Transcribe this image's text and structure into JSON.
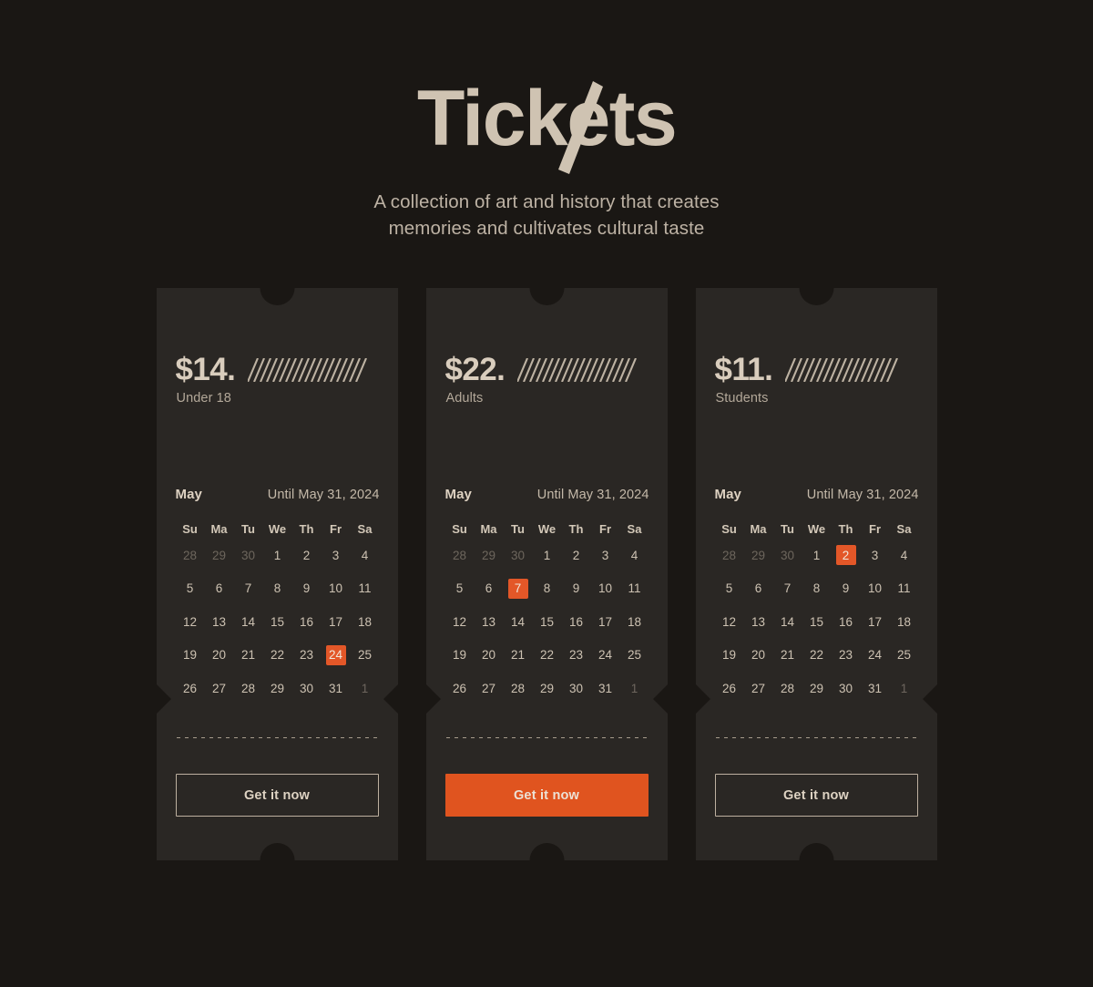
{
  "header": {
    "brand": "Tickets",
    "brand_mark_icon": "ticket-slash-mark",
    "tagline_line1": "A collection of art and history that creates",
    "tagline_line2": "memories and cultivates cultural taste"
  },
  "theme": {
    "page_background": "#1a1714",
    "card_background": "#2a2724",
    "accent": "#e0541f",
    "accent_day": "#e35728",
    "text_primary": "#d9cdbd",
    "text_muted": "#b3a899",
    "text_disabled": "#6d665d"
  },
  "calendar_common": {
    "month": "May",
    "until": "Until May 31, 2024",
    "day_initials": [
      "Su",
      "Ma",
      "Tu",
      "We",
      "Th",
      "Fr",
      "Sa"
    ],
    "weeks": [
      [
        {
          "d": "28",
          "muted": true
        },
        {
          "d": "29",
          "muted": true
        },
        {
          "d": "30",
          "muted": true
        },
        {
          "d": "1"
        },
        {
          "d": "2"
        },
        {
          "d": "3"
        },
        {
          "d": "4"
        }
      ],
      [
        {
          "d": "5"
        },
        {
          "d": "6"
        },
        {
          "d": "7"
        },
        {
          "d": "8"
        },
        {
          "d": "9"
        },
        {
          "d": "10"
        },
        {
          "d": "11"
        }
      ],
      [
        {
          "d": "12"
        },
        {
          "d": "13"
        },
        {
          "d": "14"
        },
        {
          "d": "15"
        },
        {
          "d": "16"
        },
        {
          "d": "17"
        },
        {
          "d": "18"
        }
      ],
      [
        {
          "d": "19"
        },
        {
          "d": "20"
        },
        {
          "d": "21"
        },
        {
          "d": "22"
        },
        {
          "d": "23"
        },
        {
          "d": "24"
        },
        {
          "d": "25"
        }
      ],
      [
        {
          "d": "26"
        },
        {
          "d": "27"
        },
        {
          "d": "28"
        },
        {
          "d": "29"
        },
        {
          "d": "30"
        },
        {
          "d": "31"
        },
        {
          "d": "1",
          "muted": true
        }
      ]
    ]
  },
  "tickets": [
    {
      "price": "$14.",
      "label": "Under 18",
      "hatch_icon": "diagonal-hatch-lines",
      "month": "May",
      "until": "Until May 31, 2024",
      "selected_day": "24",
      "cta_label": "Get it now",
      "cta_style": "outline"
    },
    {
      "price": "$22.",
      "label": "Adults",
      "hatch_icon": "diagonal-hatch-lines",
      "month": "May",
      "until": "Until May 31, 2024",
      "selected_day": "7",
      "cta_label": "Get it now",
      "cta_style": "filled"
    },
    {
      "price": "$11.",
      "label": "Students",
      "hatch_icon": "diagonal-hatch-lines",
      "month": "May",
      "until": "Until May 31, 2024",
      "selected_day": "2",
      "cta_label": "Get it now",
      "cta_style": "outline"
    }
  ]
}
